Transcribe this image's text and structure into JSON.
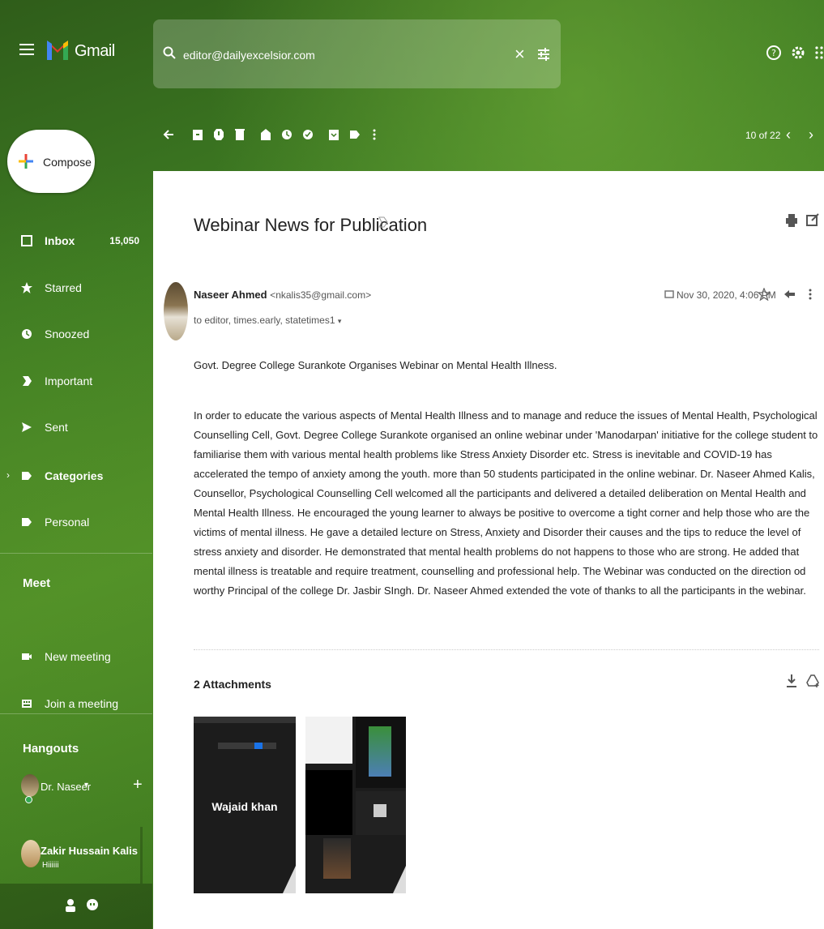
{
  "app": {
    "brand": "Gmail",
    "search_value": "editor@dailyexcelsior.com"
  },
  "toolbar": {
    "pager": "10 of 22"
  },
  "sidebar": {
    "compose_label": "Compose",
    "items": [
      {
        "label": "Inbox",
        "count": "15,050"
      },
      {
        "label": "Starred"
      },
      {
        "label": "Snoozed"
      },
      {
        "label": "Important"
      },
      {
        "label": "Sent"
      },
      {
        "label": "Categories"
      },
      {
        "label": "Personal"
      }
    ],
    "meet_title": "Meet",
    "meet_items": [
      {
        "label": "New meeting"
      },
      {
        "label": "Join a meeting"
      }
    ],
    "hangouts_title": "Hangouts",
    "hangouts_user": "Dr. Naseer",
    "chats": [
      {
        "name": "Zakir Hussain Kalis",
        "snippet": "Hiiiiii"
      }
    ]
  },
  "email": {
    "subject": "Webinar News for Publication",
    "sender_name": "Naseer Ahmed",
    "sender_email": "<nkalis35@gmail.com>",
    "to_line": "to editor, times.early, statetimes1",
    "date": "Nov 30, 2020, 4:06 PM",
    "first_line": "Govt. Degree College Surankote Organises Webinar on Mental Health Illness.",
    "body": "In order to educate the various aspects of Mental Health Illness and to manage and reduce the issues of Mental Health, Psychological Counselling Cell, Govt. Degree College Surankote organised an online webinar under 'Manodarpan' initiative for the college student to familiarise them with various mental health problems like Stress Anxiety Disorder etc.  Stress is inevitable and COVID-19 has accelerated the tempo of anxiety among the youth. more than 50 students participated in the online webinar. Dr. Naseer Ahmed Kalis, Counsellor, Psychological Counselling Cell welcomed all the participants and delivered a detailed deliberation on Mental Health  and Mental Health Illness. He encouraged the young learner to always be positive to overcome a tight corner and help those who are the victims of mental illness. He gave a detailed lecture on Stress, Anxiety and Disorder their causes and the tips to reduce the level of stress anxiety and disorder. He demonstrated that mental health problems do not happens to those who are strong. He added that mental illness is treatable and  require treatment, counselling and professional help.  The Webinar was conducted on the direction od worthy Principal of the college Dr. Jasbir SIngh. Dr. Naseer Ahmed extended the vote of thanks to all the participants in the webinar.",
    "attachments_title": "2 Attachments",
    "thumb1_label": "Wajaid khan"
  },
  "colors": {
    "accent_green": "#3d7a22",
    "panel_bg": "#ffffff"
  }
}
